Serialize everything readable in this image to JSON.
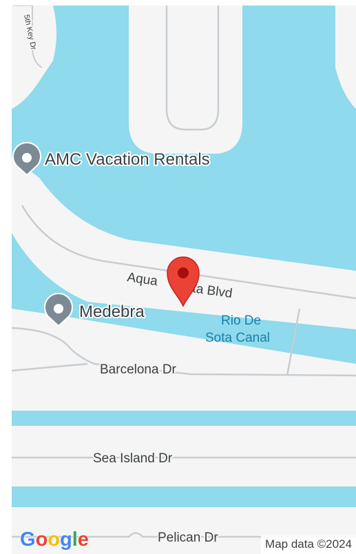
{
  "map": {
    "streets": {
      "key_dr": "5th Key Dr",
      "aqua_vista_left": "Aqua",
      "aqua_vista_right": "ta Blvd",
      "barcelona": "Barcelona Dr",
      "sea_island": "Sea Island Dr",
      "pelican": "Pelican Dr"
    },
    "water": {
      "canal_line1": "Rio De",
      "canal_line2": "Sota Canal"
    },
    "places": [
      {
        "name": "AMC Vacation Rentals",
        "icon": "place-pin-icon"
      },
      {
        "name": "Medebra",
        "icon": "place-pin-icon"
      }
    ],
    "selected_marker": {
      "icon": "red-location-pin-icon"
    },
    "attribution": "Map data ©2024",
    "logo": {
      "letters": [
        "G",
        "o",
        "o",
        "g",
        "l",
        "e"
      ],
      "colors": [
        "#4285F4",
        "#EA4335",
        "#FBBC05",
        "#4285F4",
        "#34A853",
        "#EA4335"
      ]
    },
    "colors": {
      "water": "#8fdaec",
      "land": "#f5f5f5",
      "road_outline": "#c7cdd2",
      "pin_red": "#ea4335",
      "pin_dark": "#a50e0e",
      "poi_gray": "#7b8a93"
    }
  }
}
